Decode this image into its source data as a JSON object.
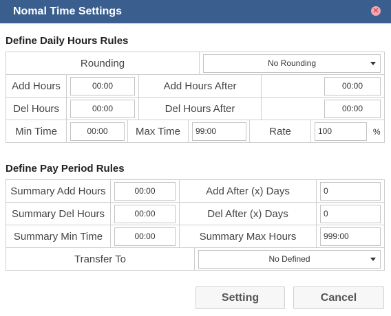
{
  "window": {
    "title": "Nomal Time Settings",
    "close_icon": "close-icon"
  },
  "daily": {
    "section_title": "Define Daily Hours Rules",
    "rounding_label": "Rounding",
    "rounding_value": "No Rounding",
    "add_hours_label": "Add Hours",
    "add_hours_value": "00:00",
    "add_hours_after_label": "Add Hours After",
    "add_hours_after_value": "00:00",
    "del_hours_label": "Del Hours",
    "del_hours_value": "00:00",
    "del_hours_after_label": "Del Hours After",
    "del_hours_after_value": "00:00",
    "min_time_label": "Min Time",
    "min_time_value": "00:00",
    "max_time_label": "Max Time",
    "max_time_value": "99:00",
    "rate_label": "Rate",
    "rate_value": "100",
    "rate_unit": "%"
  },
  "pay_period": {
    "section_title": "Define Pay Period Rules",
    "summary_add_hours_label": "Summary Add Hours",
    "summary_add_hours_value": "00:00",
    "add_after_days_label": "Add After (x) Days",
    "add_after_days_value": "0",
    "summary_del_hours_label": "Summary Del Hours",
    "summary_del_hours_value": "00:00",
    "del_after_days_label": "Del After (x) Days",
    "del_after_days_value": "0",
    "summary_min_time_label": "Summary Min Time",
    "summary_min_time_value": "00:00",
    "summary_max_hours_label": "Summary Max Hours",
    "summary_max_hours_value": "999:00",
    "transfer_to_label": "Transfer To",
    "transfer_to_value": "No Defined"
  },
  "buttons": {
    "setting": "Setting",
    "cancel": "Cancel"
  },
  "colors": {
    "titlebar": "#3a5f8e",
    "close": "#d32f4a",
    "border": "#cfcfcf"
  }
}
